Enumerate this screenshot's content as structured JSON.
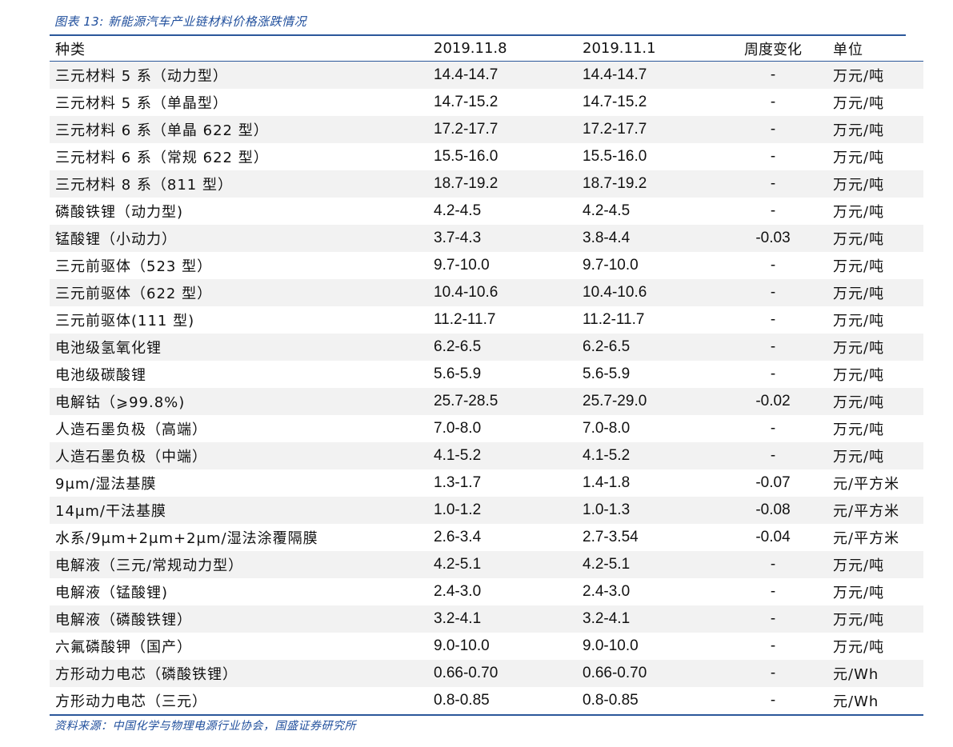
{
  "caption": "图表 13:  新能源汽车产业链材料价格涨跌情况",
  "headers": [
    "种类",
    "2019.11.8",
    "2019.11.1",
    "周度变化",
    "单位"
  ],
  "rows": [
    [
      "三元材料 5 系（动力型）",
      "14.4-14.7",
      "14.4-14.7",
      "-",
      "万元/吨"
    ],
    [
      "三元材料 5 系（单晶型）",
      "14.7-15.2",
      "14.7-15.2",
      "-",
      "万元/吨"
    ],
    [
      "三元材料 6 系（单晶 622 型）",
      "17.2-17.7",
      "17.2-17.7",
      "-",
      "万元/吨"
    ],
    [
      "三元材料 6 系（常规 622 型）",
      "15.5-16.0",
      "15.5-16.0",
      "-",
      "万元/吨"
    ],
    [
      "三元材料 8 系（811 型）",
      "18.7-19.2",
      "18.7-19.2",
      "-",
      "万元/吨"
    ],
    [
      "磷酸铁锂（动力型)",
      "4.2-4.5",
      "4.2-4.5",
      "-",
      "万元/吨"
    ],
    [
      "锰酸锂（小动力）",
      "3.7-4.3",
      "3.8-4.4",
      "-0.03",
      "万元/吨"
    ],
    [
      "三元前驱体（523 型）",
      "9.7-10.0",
      "9.7-10.0",
      "-",
      "万元/吨"
    ],
    [
      "三元前驱体（622 型）",
      "10.4-10.6",
      "10.4-10.6",
      "-",
      "万元/吨"
    ],
    [
      "三元前驱体(111 型)",
      "11.2-11.7",
      "11.2-11.7",
      "-",
      "万元/吨"
    ],
    [
      "电池级氢氧化锂",
      "6.2-6.5",
      "6.2-6.5",
      "-",
      "万元/吨"
    ],
    [
      "电池级碳酸锂",
      "5.6-5.9",
      "5.6-5.9",
      "-",
      "万元/吨"
    ],
    [
      "电解钴（⩾99.8%)",
      "25.7-28.5",
      "25.7-29.0",
      "-0.02",
      "万元/吨"
    ],
    [
      "人造石墨负极（高端）",
      "7.0-8.0",
      "7.0-8.0",
      "-",
      "万元/吨"
    ],
    [
      "人造石墨负极（中端）",
      "4.1-5.2",
      "4.1-5.2",
      "-",
      "万元/吨"
    ],
    [
      "9μm/湿法基膜",
      "1.3-1.7",
      "1.4-1.8",
      "-0.07",
      "元/平方米"
    ],
    [
      "14μm/干法基膜",
      "1.0-1.2",
      "1.0-1.3",
      "-0.08",
      "元/平方米"
    ],
    [
      "水系/9μm+2μm+2μm/湿法涂覆隔膜",
      "2.6-3.4",
      "2.7-3.54",
      "-0.04",
      "元/平方米"
    ],
    [
      "电解液（三元/常规动力型）",
      "4.2-5.1",
      "4.2-5.1",
      "-",
      "万元/吨"
    ],
    [
      "电解液（锰酸锂)",
      "2.4-3.0",
      "2.4-3.0",
      "-",
      "万元/吨"
    ],
    [
      "电解液（磷酸铁锂）",
      "3.2-4.1",
      "3.2-4.1",
      "-",
      "万元/吨"
    ],
    [
      "六氟磷酸钾（国产）",
      "9.0-10.0",
      "9.0-10.0",
      "-",
      "万元/吨"
    ],
    [
      "方形动力电芯（磷酸铁锂）",
      "0.66-0.70",
      "0.66-0.70",
      "-",
      "元/Wh"
    ],
    [
      "方形动力电芯（三元）",
      "0.8-0.85",
      "0.8-0.85",
      "-",
      "元/Wh"
    ]
  ],
  "source": "资料来源：中国化学与物理电源行业协会，国盛证券研究所",
  "colors": {
    "accent": "#2b579a",
    "caption": "#1f4e9c",
    "stripe": "#f2f2f2"
  }
}
